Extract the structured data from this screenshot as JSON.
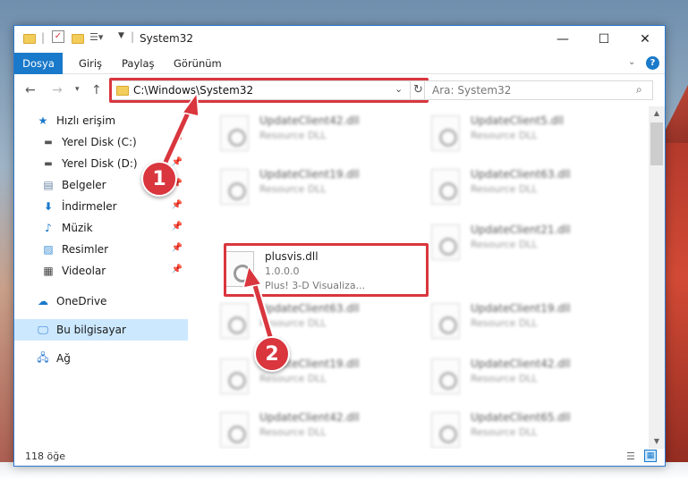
{
  "window": {
    "title": "System32",
    "controls": {
      "minimize": "—",
      "maximize": "☐",
      "close": "✕"
    }
  },
  "ribbon": {
    "tabs": [
      "Dosya",
      "Giriş",
      "Paylaş",
      "Görünüm"
    ]
  },
  "address": {
    "path": "C:\\Windows\\System32",
    "search_placeholder": "Ara: System32"
  },
  "sidebar": {
    "quick_access": "Hızlı erişim",
    "items": [
      {
        "label": "Yerel Disk (C:)",
        "icon": "drive-icon",
        "pinned": true
      },
      {
        "label": "Yerel Disk (D:)",
        "icon": "drive-icon",
        "pinned": true
      },
      {
        "label": "Belgeler",
        "icon": "documents-icon",
        "pinned": true
      },
      {
        "label": "İndirmeler",
        "icon": "download-icon",
        "pinned": true
      },
      {
        "label": "Müzik",
        "icon": "music-icon",
        "pinned": true
      },
      {
        "label": "Resimler",
        "icon": "pictures-icon",
        "pinned": true
      },
      {
        "label": "Videolar",
        "icon": "videos-icon",
        "pinned": true
      }
    ],
    "onedrive": "OneDrive",
    "this_pc": "Bu bilgisayar",
    "network": "Ağ"
  },
  "files": {
    "left": [
      {
        "name": "UpdateClient42.dll",
        "line1": "Resource DLL"
      },
      {
        "name": "UpdateClient19.dll",
        "line1": "Resource DLL"
      },
      {
        "name": "plusvis.dll",
        "line1": "1.0.0.0",
        "line2": "Plus! 3-D Visualiza..."
      },
      {
        "name": "UpdateClient63.dll",
        "line1": "Resource DLL"
      },
      {
        "name": "UpdateClient19.dll",
        "line1": "Resource DLL"
      },
      {
        "name": "UpdateClient42.dll",
        "line1": "Resource DLL"
      }
    ],
    "right": [
      {
        "name": "UpdateClient5.dll",
        "line1": "Resource DLL"
      },
      {
        "name": "UpdateClient63.dll",
        "line1": "Resource DLL"
      },
      {
        "name": "UpdateClient21.dll",
        "line1": "Resource DLL"
      },
      {
        "name": "UpdateClient19.dll",
        "line1": "Resource DLL"
      },
      {
        "name": "UpdateClient42.dll",
        "line1": "Resource DLL"
      },
      {
        "name": "UpdateClient65.dll",
        "line1": "Resource DLL"
      }
    ]
  },
  "status": {
    "item_count": "118 öğe"
  },
  "annotations": {
    "step1": "1",
    "step2": "2"
  },
  "colors": {
    "accent": "#1979ca",
    "highlight": "#d9363e",
    "selected": "#cce8ff"
  }
}
